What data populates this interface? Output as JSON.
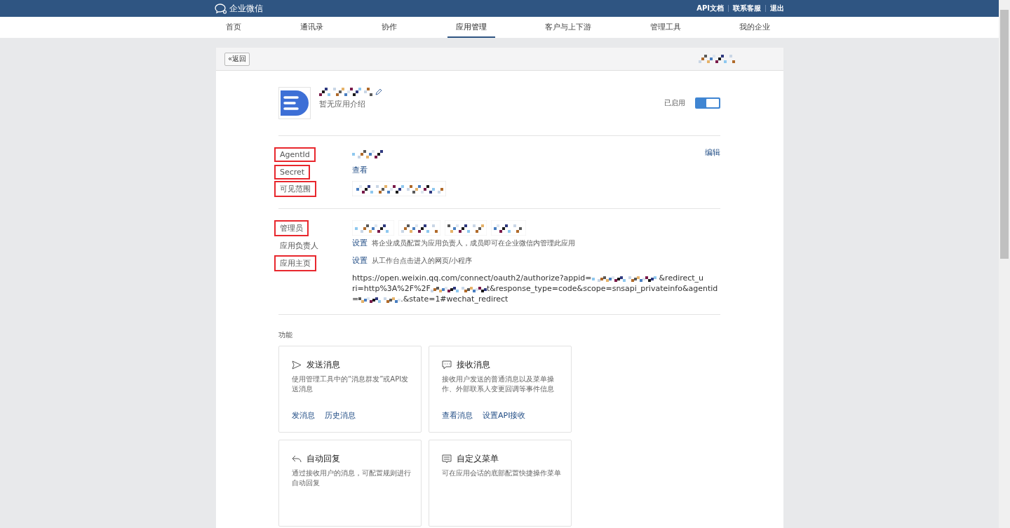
{
  "top_bar": {
    "logo": "企业微信",
    "links": [
      "API文档",
      "联系客服",
      "退出"
    ]
  },
  "nav": [
    {
      "label": "首页",
      "selected": false
    },
    {
      "label": "通讯录",
      "selected": false
    },
    {
      "label": "协作",
      "selected": false
    },
    {
      "label": "应用管理",
      "selected": true
    },
    {
      "label": "客户与上下游",
      "selected": false
    },
    {
      "label": "管理工具",
      "selected": false
    },
    {
      "label": "我的企业",
      "selected": false
    }
  ],
  "back_button": "«返回",
  "app": {
    "description": "暂无应用介绍",
    "status": "已启用",
    "enabled": true
  },
  "info_rows": [
    {
      "label": "AgentId",
      "highlighted": true,
      "kind": "mosaic",
      "action": "编辑"
    },
    {
      "label": "Secret",
      "highlighted": true,
      "kind": "link",
      "link": "查看"
    },
    {
      "label": "可见范围",
      "highlighted": true,
      "kind": "tags"
    }
  ],
  "admin_rows": [
    {
      "label": "管理员",
      "highlighted": true,
      "kind": "tags"
    },
    {
      "label": "应用负责人",
      "highlighted": false,
      "kind": "link",
      "link": "设置",
      "hint": "将企业成员配置为应用负责人，成员即可在企业微信内管理此应用"
    },
    {
      "label": "应用主页",
      "highlighted": true,
      "kind": "url",
      "link": "设置",
      "hint": "从工作台点击进入的网页/小程序",
      "url_lines": [
        [
          "https://open.weixin.qq.com/connect/oauth2/authorize?appid=",
          "&redirect_u"
        ],
        [
          "ri=http%3A%2F%2F",
          "t&response_type=code&scope=snsapi_privateinfo&agentid"
        ],
        [
          "=",
          ".&state=1#wechat_redirect"
        ]
      ]
    }
  ],
  "features": {
    "title": "功能",
    "cards": [
      {
        "kind": "send",
        "title": "发送消息",
        "description": "使用管理工具中的“消息群发”或API发送消息",
        "links": [
          "发消息",
          "历史消息"
        ]
      },
      {
        "kind": "chat",
        "title": "接收消息",
        "description": "接收用户发送的普通消息以及菜单操作、外部联系人变更回调等事件信息",
        "links": [
          "查看消息",
          "设置API接收"
        ]
      },
      {
        "kind": "reply",
        "title": "自动回复",
        "description": "通过接收用户的消息，可配置规则进行自动回复"
      },
      {
        "kind": "menu",
        "title": "自定义菜单",
        "description": "可在应用会话的底部配置快捷操作菜单"
      }
    ]
  }
}
